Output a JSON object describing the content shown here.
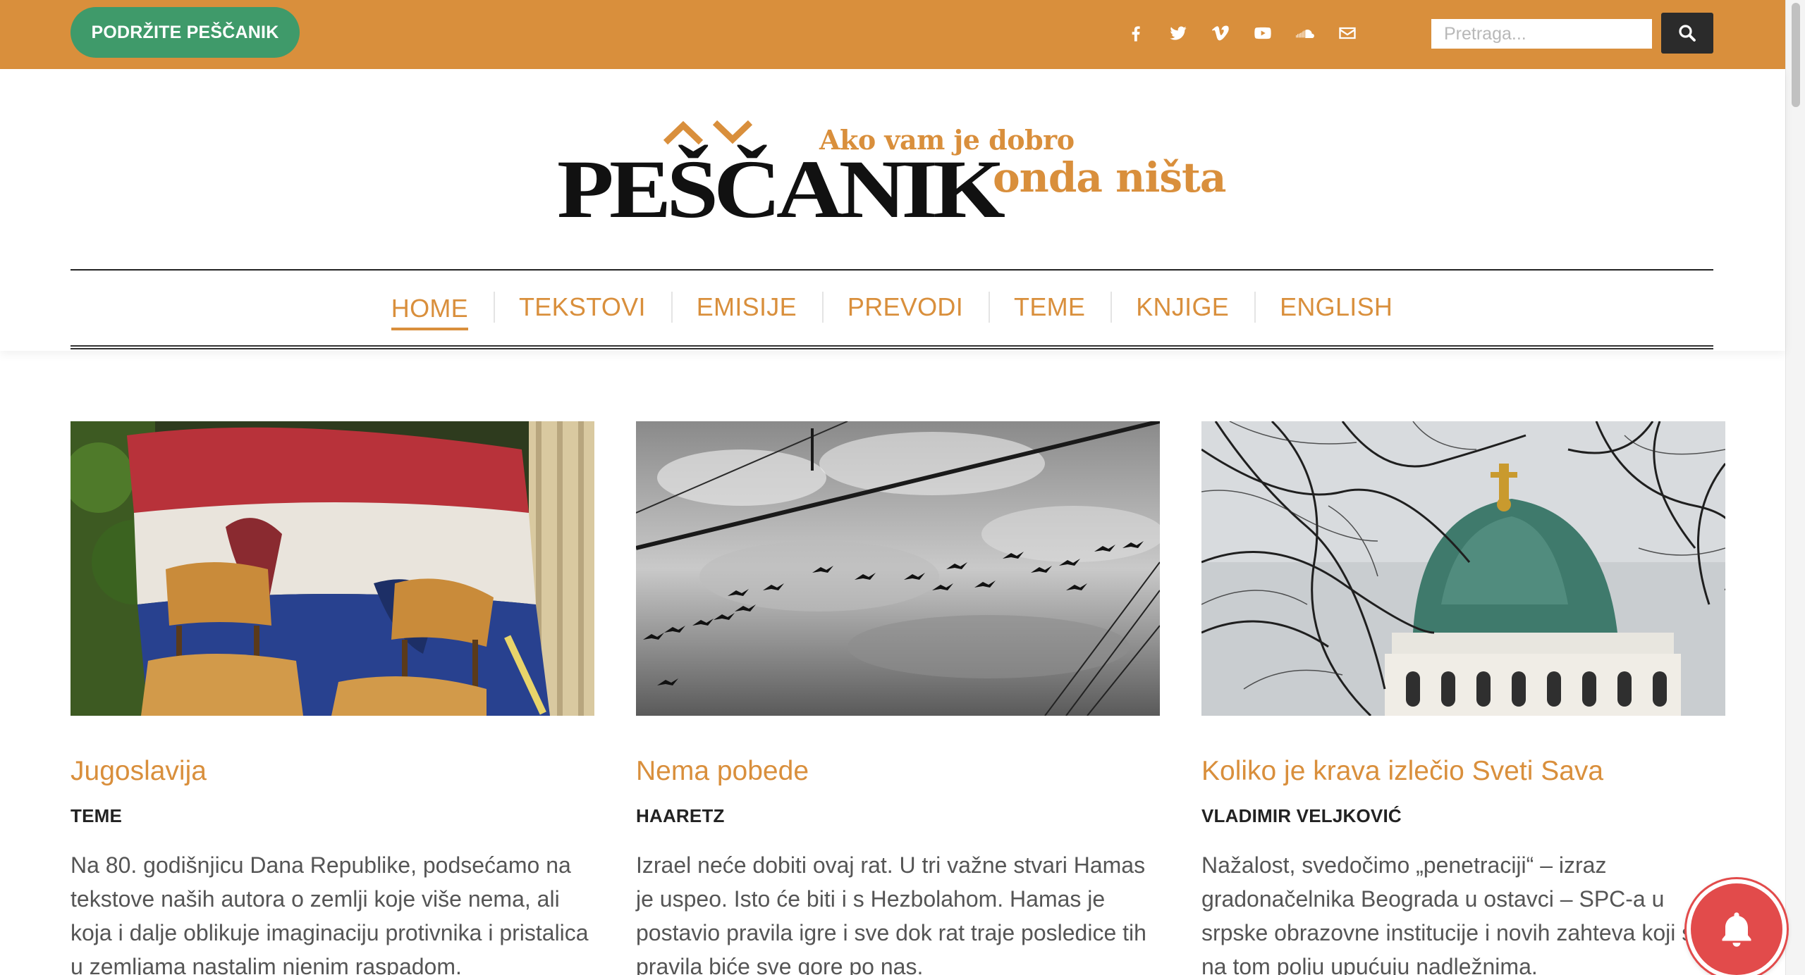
{
  "topbar": {
    "support_label": "PODRŽITE PEŠČANIK",
    "socials": [
      "facebook-icon",
      "twitter-icon",
      "vimeo-icon",
      "youtube-icon",
      "soundcloud-icon",
      "email-icon"
    ],
    "search_placeholder": "Pretraga...",
    "bar_color": "#d98f3c",
    "support_color": "#3f9a6a"
  },
  "logo": {
    "name": "PEŠČANIK",
    "tagline_line1": "Ako vam je dobro",
    "tagline_line2": "onda ništa"
  },
  "nav": {
    "items": [
      {
        "label": "HOME",
        "active": true
      },
      {
        "label": "TEKSTOVI",
        "active": false
      },
      {
        "label": "EMISIJE",
        "active": false
      },
      {
        "label": "PREVODI",
        "active": false
      },
      {
        "label": "TEME",
        "active": false
      },
      {
        "label": "KNJIGE",
        "active": false
      },
      {
        "label": "ENGLISH",
        "active": false
      }
    ]
  },
  "articles": [
    {
      "title": "Jugoslavija",
      "author": "TEME",
      "excerpt": "Na 80. godišnjicu Dana Republike, podsećamo na tekstove naših autora o zemlji koje više nema, ali koja i dalje oblikuje imaginaciju protivnika i pristalica u zemljama nastalim njenim raspadom."
    },
    {
      "title": "Nema pobede",
      "author": "HAARETZ",
      "excerpt": "Izrael neće dobiti ovaj rat. U tri važne stvari Hamas je uspeo. Isto će biti i s Hezbolahom. Hamas je postavio pravila igre i sve dok rat traje posledice tih pravila biće sve gore po nas."
    },
    {
      "title": "Koliko je krava izlečio Sveti Sava",
      "author": "VLADIMIR VELJKOVIĆ",
      "excerpt": "Nažalost, svedočimo „penetraciji“ – izraz gradonačelnika Beograda u ostavci – SPC-a u srpske obrazovne institucije i novih zahteva koji se na tom polju upućuju nadležnima."
    }
  ]
}
